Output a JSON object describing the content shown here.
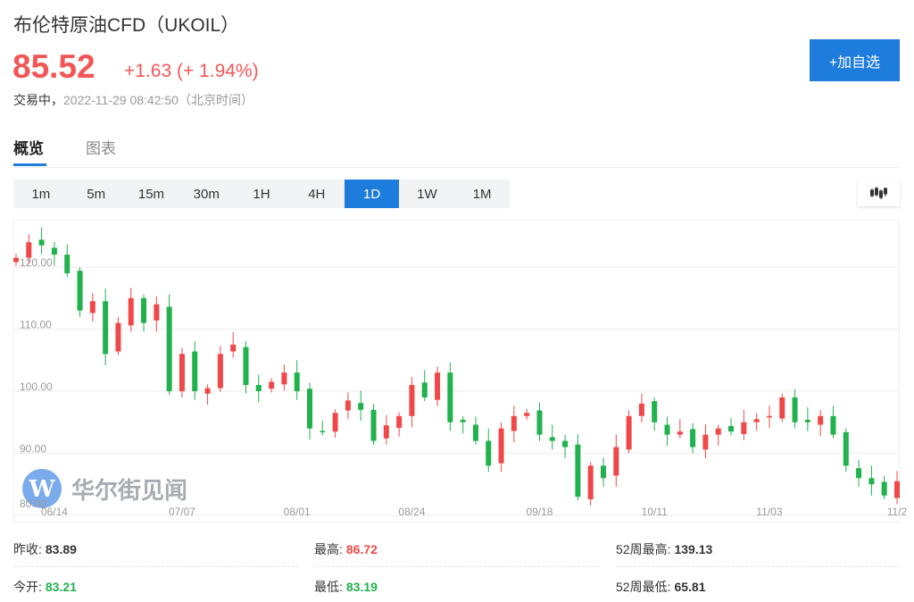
{
  "header": {
    "title": "布伦特原油CFD（UKOIL）",
    "price": "85.52",
    "change": "+1.63 (+ 1.94%)",
    "status": "交易中，",
    "timestamp": "2022-11-29 08:42:50（北京时间）",
    "add_button": "+加自选"
  },
  "tabs": [
    {
      "label": "概览",
      "active": true
    },
    {
      "label": "图表",
      "active": false
    }
  ],
  "intervals": [
    {
      "label": "1m"
    },
    {
      "label": "5m"
    },
    {
      "label": "15m"
    },
    {
      "label": "30m"
    },
    {
      "label": "1H"
    },
    {
      "label": "4H"
    },
    {
      "label": "1D",
      "active": true
    },
    {
      "label": "1W"
    },
    {
      "label": "1M"
    }
  ],
  "chart_type_icon": "candlestick-icon",
  "watermark": "华尔街见闻",
  "colors": {
    "up": "#f04848",
    "down": "#21b14d",
    "accent": "#1e7cdc"
  },
  "chart_data": {
    "type": "candlestick",
    "y_ticks": [
      "120.00",
      "110.00",
      "100.00",
      "90.00",
      "80.00"
    ],
    "y_tick_values": [
      120,
      110,
      100,
      90,
      80
    ],
    "x_ticks": [
      "06/14",
      "07/07",
      "08/01",
      "08/24",
      "09/18",
      "10/11",
      "11/03",
      "11/2"
    ],
    "x_tick_index": [
      3,
      13,
      22,
      31,
      41,
      50,
      59,
      69
    ],
    "close": [
      121.5,
      124,
      123.5,
      122,
      119,
      113,
      114.5,
      106,
      111,
      115,
      111,
      114,
      100,
      106,
      100,
      100.5,
      106,
      107.5,
      101,
      100,
      101.5,
      103,
      100,
      94,
      93.5,
      96.5,
      98.5,
      97,
      92,
      94.5,
      96,
      101,
      99,
      103,
      95,
      95,
      92,
      88,
      94,
      96,
      96.5,
      93,
      92,
      91,
      83,
      88,
      86,
      91,
      96,
      98,
      95,
      93,
      93.5,
      91,
      93,
      94,
      93.5,
      95,
      95.5,
      96,
      99,
      95,
      95,
      96,
      93,
      88,
      86,
      85,
      83.2,
      85.5
    ],
    "open_first": 120.8,
    "ylim": [
      78,
      128
    ]
  },
  "stats": [
    {
      "label": "昨收:",
      "value": "83.89",
      "color": "#333333"
    },
    {
      "label": "最高:",
      "value": "86.72",
      "color": "#f04848"
    },
    {
      "label": "52周最高:",
      "value": "139.13",
      "color": "#333333"
    },
    {
      "label": "今开:",
      "value": "83.21",
      "color": "#21b14d"
    },
    {
      "label": "最低:",
      "value": "83.19",
      "color": "#21b14d"
    },
    {
      "label": "52周最低:",
      "value": "65.81",
      "color": "#333333"
    }
  ]
}
